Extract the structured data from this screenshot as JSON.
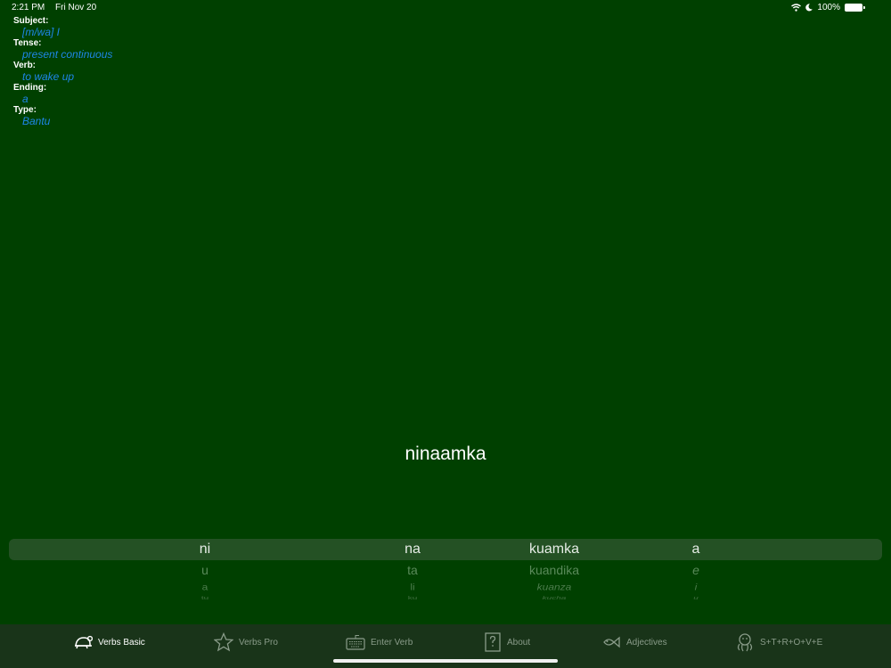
{
  "status": {
    "time": "2:21 PM",
    "date": "Fri Nov 20",
    "battery": "100%"
  },
  "info": [
    {
      "label": "Subject:",
      "value": "[m/wa] I"
    },
    {
      "label": "Tense:",
      "value": "present continuous"
    },
    {
      "label": "Verb:",
      "value": "to wake up"
    },
    {
      "label": "Ending:",
      "value": "a"
    },
    {
      "label": "Type:",
      "value": "Bantu"
    }
  ],
  "result": "ninaamka",
  "picker": {
    "columns": [
      {
        "name": "subject",
        "rows": [
          "ni",
          "u",
          "a",
          "tu"
        ]
      },
      {
        "name": "tense",
        "rows": [
          "na",
          "ta",
          "li",
          "ku"
        ]
      },
      {
        "name": "verb",
        "rows": [
          "kuamka",
          "kuandika",
          "kuanza",
          "kucha"
        ]
      },
      {
        "name": "ending",
        "rows": [
          "a",
          "e",
          "i",
          "u"
        ]
      }
    ]
  },
  "tabs": [
    {
      "label": "Verbs Basic",
      "icon": "turtle-icon",
      "active": true
    },
    {
      "label": "Verbs Pro",
      "icon": "star-icon",
      "active": false
    },
    {
      "label": "Enter Verb",
      "icon": "keyboard-icon",
      "active": false
    },
    {
      "label": "About",
      "icon": "question-book-icon",
      "active": false
    },
    {
      "label": "Adjectives",
      "icon": "fish-icon",
      "active": false
    },
    {
      "label": "S+T+R+O+V+E",
      "icon": "octopus-icon",
      "active": false
    }
  ],
  "colors": {
    "background": "#004000",
    "accent": "#1e86e8",
    "tabbar": "#193419"
  }
}
